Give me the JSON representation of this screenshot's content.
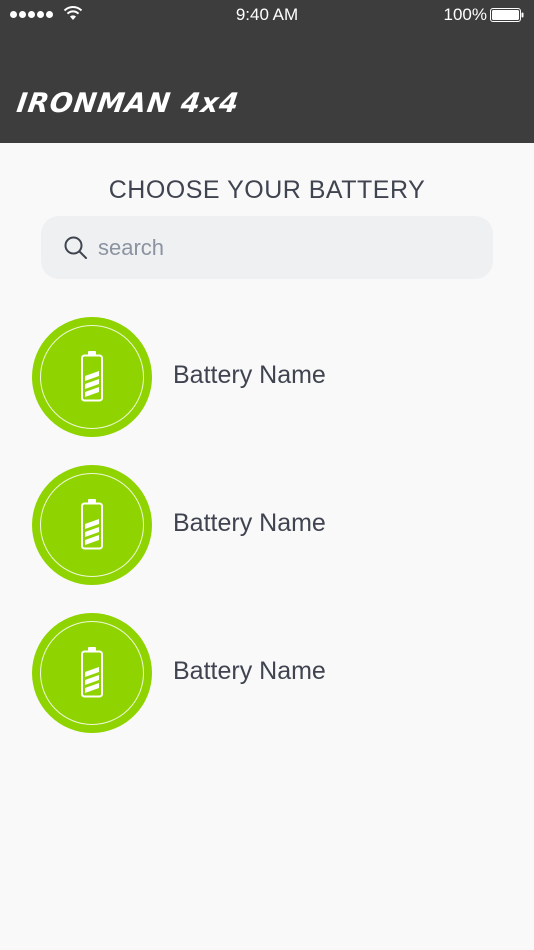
{
  "status_bar": {
    "time": "9:40 AM",
    "battery": "100%",
    "signal_icon": "signal-dots-icon",
    "wifi_icon": "wifi-icon",
    "battery_icon": "battery-status-icon"
  },
  "header": {
    "brand": "IRONMAN 4x4",
    "background": "#3d3d3d"
  },
  "main": {
    "title": "CHOOSE YOUR BATTERY",
    "search": {
      "placeholder": "search",
      "value": "",
      "icon": "search-icon"
    },
    "items": [
      {
        "label": "Battery Name",
        "icon": "battery-icon"
      },
      {
        "label": "Battery Name",
        "icon": "battery-icon"
      },
      {
        "label": "Battery Name",
        "icon": "battery-icon"
      }
    ]
  },
  "colors": {
    "accent": "#8fd400",
    "text": "#3f4450",
    "page_bg": "#f9f9f9",
    "search_bg": "#eff0f2"
  }
}
